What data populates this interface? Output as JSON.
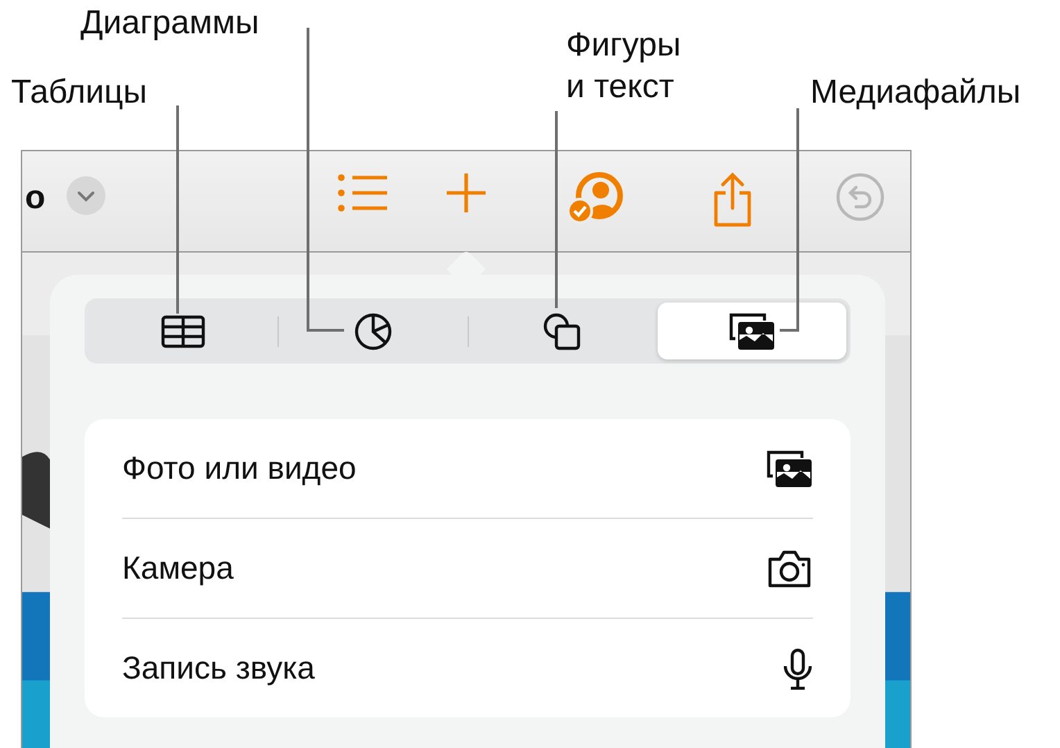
{
  "callouts": [
    {
      "label": "Таблицы"
    },
    {
      "label": "Диаграммы"
    },
    {
      "label": "Фигуры и текст"
    },
    {
      "label": "Медиафайлы"
    }
  ],
  "toolbar": {
    "title": "o",
    "undo_disabled": true
  },
  "tabs": [
    {
      "kind": "table",
      "selected": false
    },
    {
      "kind": "chart",
      "selected": false
    },
    {
      "kind": "shape",
      "selected": false
    },
    {
      "kind": "media",
      "selected": true
    }
  ],
  "menu": [
    {
      "label": "Фото или видео"
    },
    {
      "label": "Камера",
      "kind": "camera"
    },
    {
      "label": "Запись звука",
      "kind": "microphone"
    }
  ]
}
